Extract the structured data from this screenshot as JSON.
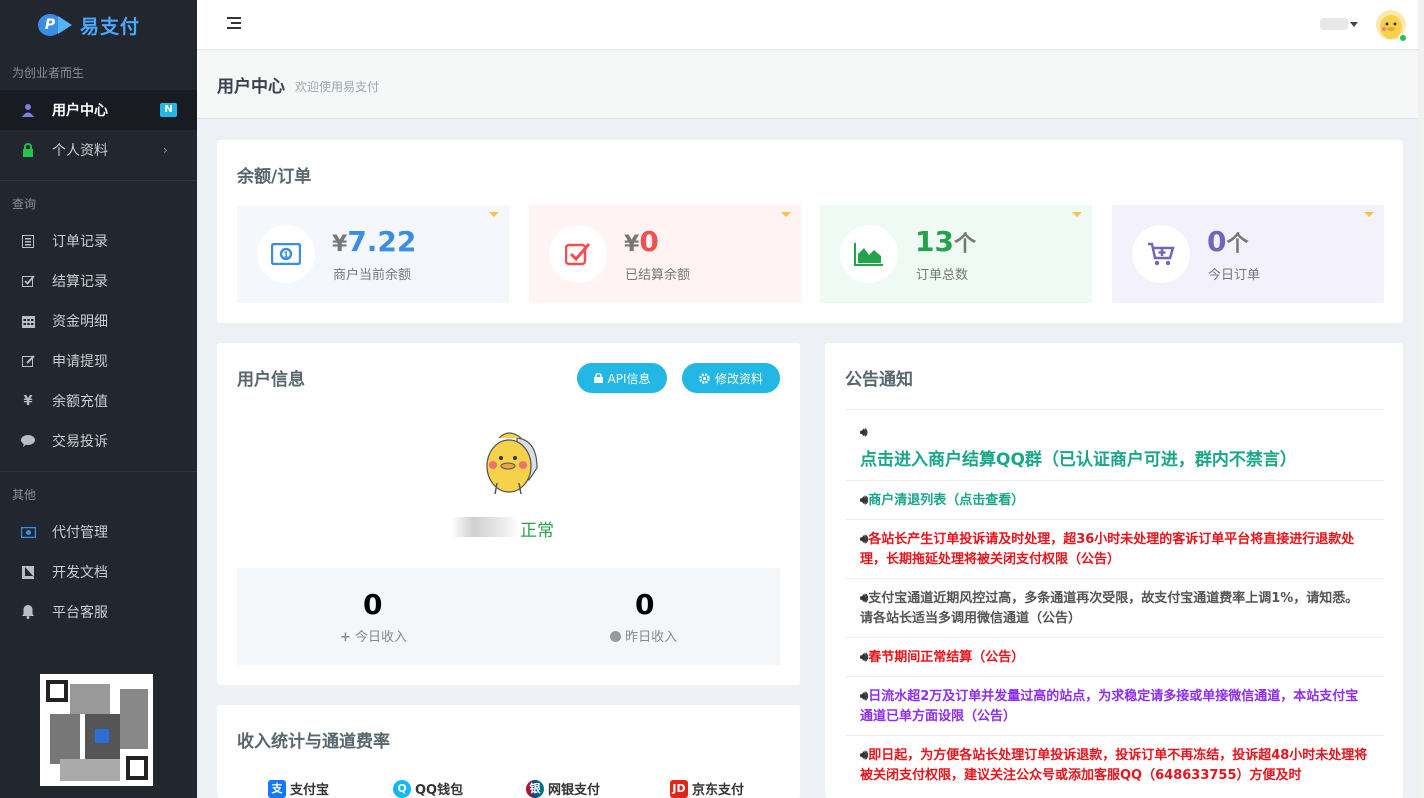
{
  "brand": {
    "name": "易支付",
    "slogan": "为创业者而生"
  },
  "sidebar": {
    "main_items": [
      {
        "label": "用户中心",
        "badge": "N"
      },
      {
        "label": "个人资料"
      }
    ],
    "section_query": "查询",
    "query_items": [
      {
        "label": "订单记录"
      },
      {
        "label": "结算记录"
      },
      {
        "label": "资金明细"
      },
      {
        "label": "申请提现"
      },
      {
        "label": "余额充值"
      },
      {
        "label": "交易投诉"
      }
    ],
    "section_other": "其他",
    "other_items": [
      {
        "label": "代付管理"
      },
      {
        "label": "开发文档"
      },
      {
        "label": "平台客服"
      }
    ]
  },
  "header": {
    "title": "用户中心",
    "subtitle": "欢迎使用易支付"
  },
  "balance_panel": {
    "title": "余额/订单",
    "stats": [
      {
        "prefix": "¥",
        "value": "7.22",
        "label": "商户当前余额",
        "color": "#3b8ee3"
      },
      {
        "prefix": "¥",
        "value": "0",
        "label": "已结算余额",
        "color": "#f05050"
      },
      {
        "prefix": "",
        "value": "13",
        "suffix": "个",
        "label": "订单总数",
        "color": "#27c24c"
      },
      {
        "prefix": "",
        "value": "0",
        "suffix": "个",
        "label": "今日订单",
        "color": "#7266ba"
      }
    ]
  },
  "user_panel": {
    "title": "用户信息",
    "api_button": "API信息",
    "edit_button": "修改资料",
    "status": "正常",
    "today_income": {
      "value": "0",
      "label": "今日收入"
    },
    "yesterday_income": {
      "value": "0",
      "label": "昨日收入"
    }
  },
  "notice_panel": {
    "title": "公告通知",
    "items": [
      {
        "text": "点击进入商户结算QQ群（已认证商户可进，群内不禁言）",
        "color": "#1aa68a"
      },
      {
        "text": "商户清退列表（点击查看）",
        "color": "#1aa68a"
      },
      {
        "text": "各站长产生订单投诉请及时处理，超36小时未处理的客诉订单平台将直接进行退款处理，长期拖延处理将被关闭支付权限（公告）",
        "color": "#e8141c"
      },
      {
        "text": "支付宝通道近期风控过高，多条通道再次受限，故支付宝通道费率上调1%，请知悉。请各站长适当多调用微信通道（公告）",
        "color": "#555555"
      },
      {
        "text": "春节期间正常结算（公告）",
        "color": "#e8141c"
      },
      {
        "text": "日流水超2万及订单并发量过高的站点，为求稳定请多接或单接微信通道，本站支付宝通道已单方面设限（公告）",
        "color": "#8e2ff0"
      },
      {
        "text": "即日起，为方便各站长处理订单投诉退款，投诉订单不再冻结，投诉超48小时未处理将被关闭支付权限，建议关注公众号或添加客服QQ（648633755）方便及时",
        "color": "#e8141c"
      }
    ]
  },
  "rates_panel": {
    "title": "收入统计与通道费率",
    "channels": [
      {
        "label": "支付宝",
        "color": "#1677ff",
        "icon": "alipay-icon"
      },
      {
        "label": "QQ钱包",
        "color": "#12b7f5",
        "icon": "qq-icon"
      },
      {
        "label": "网银支付",
        "color": "#e60012",
        "icon": "unionpay-icon"
      },
      {
        "label": "京东支付",
        "color": "#e1251b",
        "icon": "jd-icon"
      }
    ]
  }
}
